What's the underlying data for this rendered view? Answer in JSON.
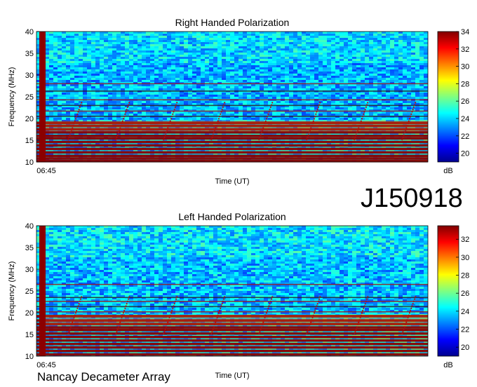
{
  "dataset_id": "J150918",
  "footer": "Nancay Decameter Array",
  "chart_data": [
    {
      "type": "heatmap",
      "title": "Right Handed Polarization",
      "xlabel": "Time (UT)",
      "ylabel": "Frequency (MHz)",
      "x_ticks": [
        "06:45"
      ],
      "y_ticks": [
        10,
        15,
        20,
        25,
        30,
        35,
        40
      ],
      "ylim": [
        10,
        40
      ],
      "colorbar": {
        "label": "dB",
        "ticks": [
          20,
          22,
          24,
          26,
          28,
          30,
          32,
          34
        ],
        "range": [
          19,
          34
        ]
      },
      "colormap": "jet",
      "noise_base_db": 23.5,
      "hot_channels_mhz": [
        10.2,
        10.8,
        11.4,
        12.2,
        13.0,
        13.8,
        14.6,
        15.4,
        16.0,
        16.8,
        17.5,
        18.3,
        19.0,
        20.5,
        21.7,
        23.0,
        24.3,
        26.3,
        28.0
      ],
      "burst_count": 8,
      "burst_freq_range_mhz": [
        15,
        24
      ]
    },
    {
      "type": "heatmap",
      "title": "Left Handed Polarization",
      "xlabel": "Time (UT)",
      "ylabel": "Frequency (MHz)",
      "x_ticks": [
        "06:45"
      ],
      "y_ticks": [
        10,
        15,
        20,
        25,
        30,
        35,
        40
      ],
      "ylim": [
        10,
        40
      ],
      "colorbar": {
        "label": "dB",
        "ticks": [
          20,
          22,
          24,
          26,
          28,
          30,
          32
        ],
        "range": [
          19,
          33.5
        ]
      },
      "colormap": "jet",
      "noise_base_db": 23.5,
      "hot_channels_mhz": [
        10.4,
        11.2,
        12.0,
        12.8,
        13.6,
        14.4,
        15.2,
        16.0,
        16.6,
        17.4,
        18.2,
        19.2,
        20.2,
        21.4,
        22.6,
        23.5,
        26.5
      ],
      "burst_count": 8,
      "burst_freq_range_mhz": [
        15,
        24
      ]
    }
  ]
}
